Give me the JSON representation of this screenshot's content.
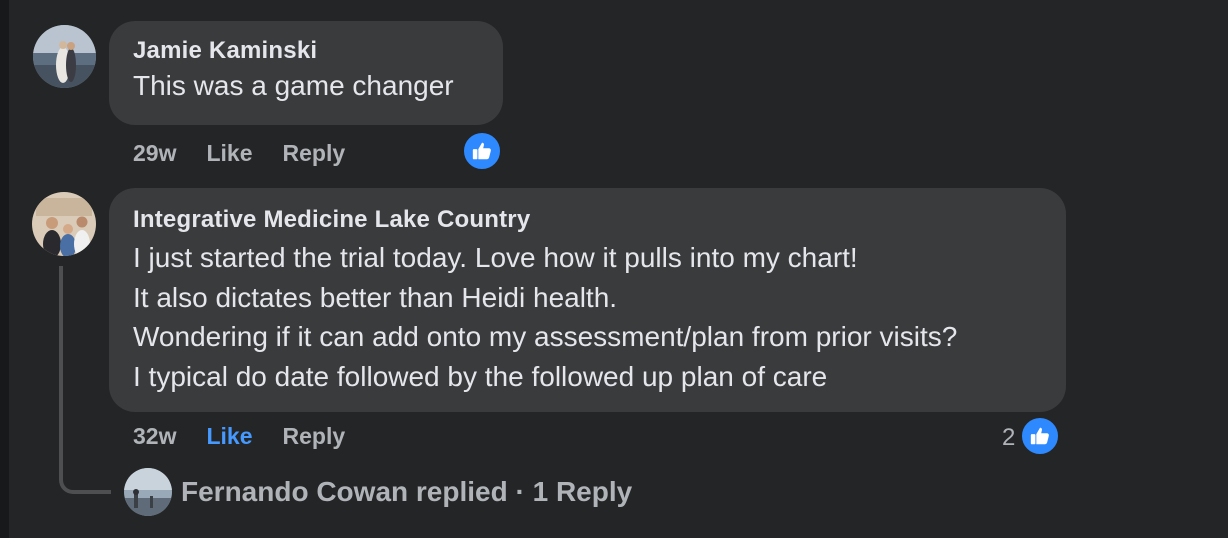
{
  "comments": [
    {
      "author": "Jamie Kaminski",
      "lines": [
        "This was a game changer"
      ],
      "time": "29w",
      "like_label": "Like",
      "reply_label": "Reply",
      "reaction_icon": "thumbs-up-icon",
      "reaction_count": ""
    },
    {
      "author": "Integrative Medicine Lake Country",
      "lines": [
        "I just started the trial today. Love how it pulls into my chart!",
        "It also dictates better than Heidi health.",
        "Wondering if it can add onto my assessment/plan from prior visits?",
        "I typical do date followed by the followed up plan of care"
      ],
      "time": "32w",
      "like_label": "Like",
      "like_active": true,
      "reply_label": "Reply",
      "reaction_icon": "thumbs-up-icon",
      "reaction_count": "2"
    }
  ],
  "reply_thread": {
    "text": "Fernando Cowan replied · 1 Reply"
  },
  "colors": {
    "background": "#242526",
    "bubble": "#3a3b3c",
    "like_active": "#4599ff",
    "reaction": "#2e89ff"
  }
}
